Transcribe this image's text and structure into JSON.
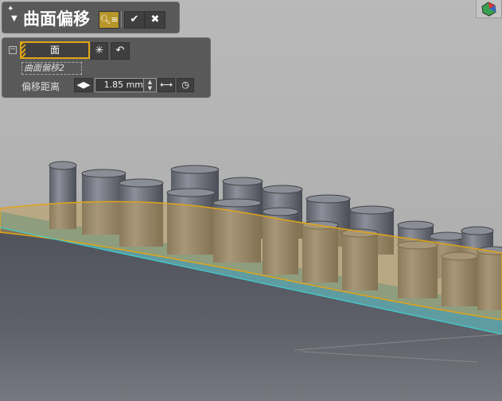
{
  "command": {
    "title": "曲面偏移",
    "filter_icon": "filter-icon",
    "ok_icon": "check-icon",
    "cancel_icon": "close-icon"
  },
  "options": {
    "collapse": "−",
    "face_label": "面",
    "feature_name": "曲面偏移2",
    "distance_label": "偏移距离",
    "distance_value": "1.85 mm"
  },
  "colors": {
    "panel": "#595959",
    "accent": "#e0a418",
    "surface": "#c8a050",
    "edge": "#40d0d0"
  }
}
